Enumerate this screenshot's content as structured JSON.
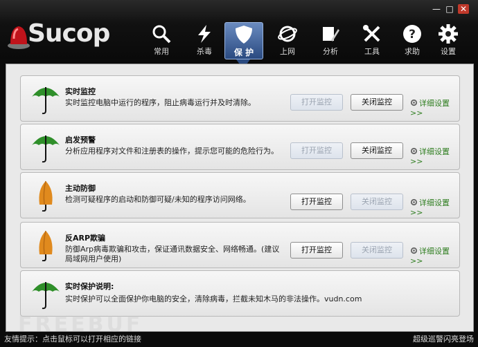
{
  "app": {
    "logo_text": "Sucop"
  },
  "nav": [
    {
      "label": "常用",
      "icon": "magnifier-icon"
    },
    {
      "label": "杀毒",
      "icon": "lightning-icon"
    },
    {
      "label": "保 护",
      "icon": "shield-icon",
      "active": true
    },
    {
      "label": "上网",
      "icon": "globe-icon"
    },
    {
      "label": "分析",
      "icon": "pen-icon"
    },
    {
      "label": "工具",
      "icon": "tools-icon"
    },
    {
      "label": "求助",
      "icon": "help-icon"
    },
    {
      "label": "设置",
      "icon": "gear-icon"
    }
  ],
  "panels": [
    {
      "title": "实时监控",
      "desc": "实时监控电脑中运行的程序，阻止病毒运行并及时清除。",
      "umbrella": "green",
      "open_label": "打开监控",
      "close_label": "关闭监控",
      "open_enabled": false,
      "close_enabled": true,
      "detail_label": "详细设置>>"
    },
    {
      "title": "启发预警",
      "desc": "分析应用程序对文件和注册表的操作，提示您可能的危险行为。",
      "umbrella": "green",
      "open_label": "打开监控",
      "close_label": "关闭监控",
      "open_enabled": false,
      "close_enabled": true,
      "detail_label": "详细设置>>"
    },
    {
      "title": "主动防御",
      "desc": "检测可疑程序的启动和防御可疑/未知的程序访问网络。",
      "umbrella": "orange",
      "open_label": "打开监控",
      "close_label": "关闭监控",
      "open_enabled": true,
      "close_enabled": false,
      "detail_label": "详细设置>>"
    },
    {
      "title": "反ARP欺骗",
      "desc": "防御Arp病毒欺骗和攻击，保证通讯数据安全、网络畅通。(建议局域网用户使用)",
      "umbrella": "orange",
      "open_label": "打开监控",
      "close_label": "关闭监控",
      "open_enabled": true,
      "close_enabled": false,
      "detail_label": "详细设置>>"
    },
    {
      "title": "实时保护说明:",
      "desc": "实时保护可以全面保护你电脑的安全，清除病毒，拦截未知木马的非法操作。vudn.com",
      "umbrella": "green"
    }
  ],
  "status": {
    "left": "友情提示：点击鼠标可以打开相应的链接",
    "right": "超级巡警闪亮登场"
  },
  "watermark": "FREEBUF",
  "colors": {
    "green": "#2f8f2a",
    "orange": "#e08a1e",
    "accent": "#2a4a80",
    "link": "#2e7d1f"
  }
}
